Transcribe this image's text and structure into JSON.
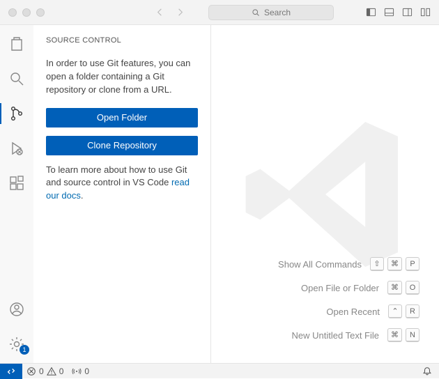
{
  "titlebar": {
    "search_placeholder": "Search"
  },
  "activity": {
    "manage_badge": "1"
  },
  "sidebar": {
    "title": "SOURCE CONTROL",
    "intro": "In order to use Git features, you can open a folder containing a Git repository or clone from a URL.",
    "open_folder": "Open Folder",
    "clone_repo": "Clone Repository",
    "learn_more_pre": "To learn more about how to use Git and source control in VS Code ",
    "learn_more_link": "read our docs",
    "learn_more_post": "."
  },
  "welcome": {
    "shortcuts": [
      {
        "label": "Show All Commands",
        "keys": [
          "⇧",
          "⌘",
          "P"
        ]
      },
      {
        "label": "Open File or Folder",
        "keys": [
          "⌘",
          "O"
        ]
      },
      {
        "label": "Open Recent",
        "keys": [
          "⌃",
          "R"
        ]
      },
      {
        "label": "New Untitled Text File",
        "keys": [
          "⌘",
          "N"
        ]
      }
    ]
  },
  "status": {
    "errors": "0",
    "warnings": "0",
    "ports": "0"
  }
}
